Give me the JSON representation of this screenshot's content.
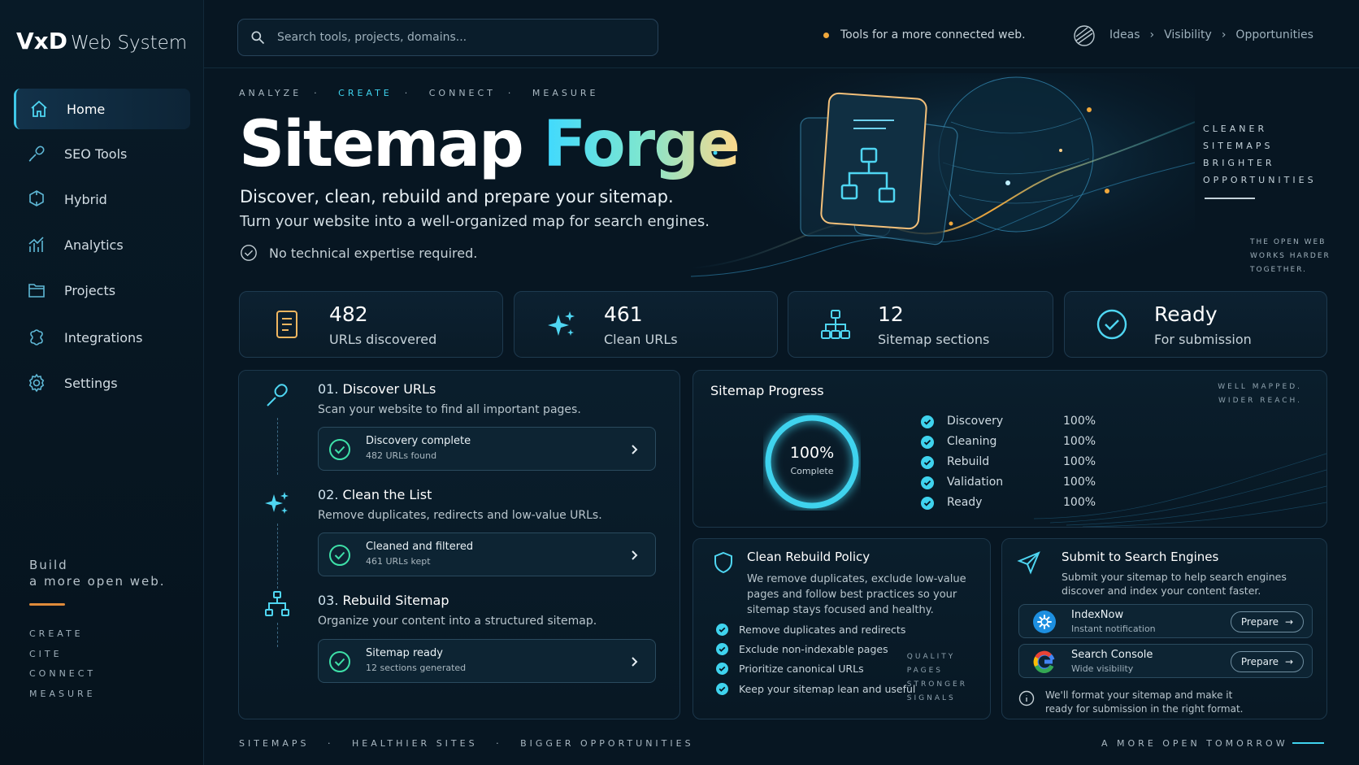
{
  "brand": {
    "name_bold": "VxD",
    "name_rest": "Web System"
  },
  "sidebar": {
    "items": [
      {
        "label": "Home"
      },
      {
        "label": "SEO Tools"
      },
      {
        "label": "Hybrid"
      },
      {
        "label": "Analytics"
      },
      {
        "label": "Projects"
      },
      {
        "label": "Integrations"
      },
      {
        "label": "Settings"
      }
    ],
    "tagline_1": "Build",
    "tagline_2": "a more open web.",
    "words": [
      "CREATE",
      "CITE",
      "CONNECT",
      "MEASURE"
    ]
  },
  "search": {
    "placeholder": "Search tools, projects, domains..."
  },
  "header": {
    "tagline": "Tools for a more connected web.",
    "crumbs": [
      "Ideas",
      "Visibility",
      "Opportunities"
    ]
  },
  "hero": {
    "kicker": [
      "ANALYZE",
      "CREATE",
      "CONNECT",
      "MEASURE"
    ],
    "title_1": "Sitemap",
    "title_2": "Forge",
    "subtitle_1": "Discover, clean, rebuild and prepare your sitemap.",
    "subtitle_2": "Turn your website into a well-organized map for search engines.",
    "note": "No technical expertise required.",
    "side_words": [
      "CLEANER",
      "SITEMAPS",
      "BRIGHTER",
      "OPPORTUNITIES"
    ],
    "side_words_2": [
      "THE OPEN WEB",
      "WORKS HARDER",
      "TOGETHER."
    ]
  },
  "stats": [
    {
      "value": "482",
      "label": "URLs discovered"
    },
    {
      "value": "461",
      "label": "Clean URLs"
    },
    {
      "value": "12",
      "label": "Sitemap sections"
    },
    {
      "value": "Ready",
      "label": "For submission"
    }
  ],
  "steps": [
    {
      "num": "01.",
      "title": "Discover URLs",
      "desc": "Scan your website to find all important pages.",
      "status": "Discovery complete",
      "detail": "482 URLs found"
    },
    {
      "num": "02.",
      "title": "Clean the List",
      "desc": "Remove duplicates, redirects and low-value URLs.",
      "status": "Cleaned and filtered",
      "detail": "461 URLs kept"
    },
    {
      "num": "03.",
      "title": "Rebuild Sitemap",
      "desc": "Organize your content into a structured sitemap.",
      "status": "Sitemap ready",
      "detail": "12 sections generated"
    }
  ],
  "progress": {
    "title": "Sitemap Progress",
    "value": "100%",
    "value_fraction": 1.0,
    "caption": "Complete",
    "watermark": [
      "WELL MAPPED.",
      "WIDER REACH."
    ],
    "rows": [
      {
        "name": "Discovery",
        "pct": "100%"
      },
      {
        "name": "Cleaning",
        "pct": "100%"
      },
      {
        "name": "Rebuild",
        "pct": "100%"
      },
      {
        "name": "Validation",
        "pct": "100%"
      },
      {
        "name": "Ready",
        "pct": "100%"
      }
    ]
  },
  "policy": {
    "title": "Clean Rebuild Policy",
    "desc": "We remove duplicates, exclude low-value pages and follow best practices so your sitemap stays focused and healthy.",
    "items": [
      "Remove duplicates and redirects",
      "Exclude non-indexable pages",
      "Prioritize canonical URLs",
      "Keep your sitemap lean and useful"
    ],
    "watermark": [
      "QUALITY",
      "PAGES",
      "STRONGER",
      "SIGNALS"
    ]
  },
  "submit": {
    "title": "Submit to Search Engines",
    "desc": "Submit your sitemap to help search engines discover and index your content faster.",
    "engines": [
      {
        "name": "IndexNow",
        "detail": "Instant notification",
        "button": "Prepare"
      },
      {
        "name": "Search Console",
        "detail": "Wide visibility",
        "button": "Prepare"
      }
    ],
    "note": "We'll format your sitemap and make it ready for submission in the right format."
  },
  "footer": {
    "left": [
      "SITEMAPS",
      "HEALTHIER SITES",
      "BIGGER OPPORTUNITIES"
    ],
    "right": "A MORE OPEN TOMORROW"
  },
  "colors": {
    "accent": "#3fd3ee",
    "warm": "#f0a83c",
    "success": "#3ee0a8"
  }
}
